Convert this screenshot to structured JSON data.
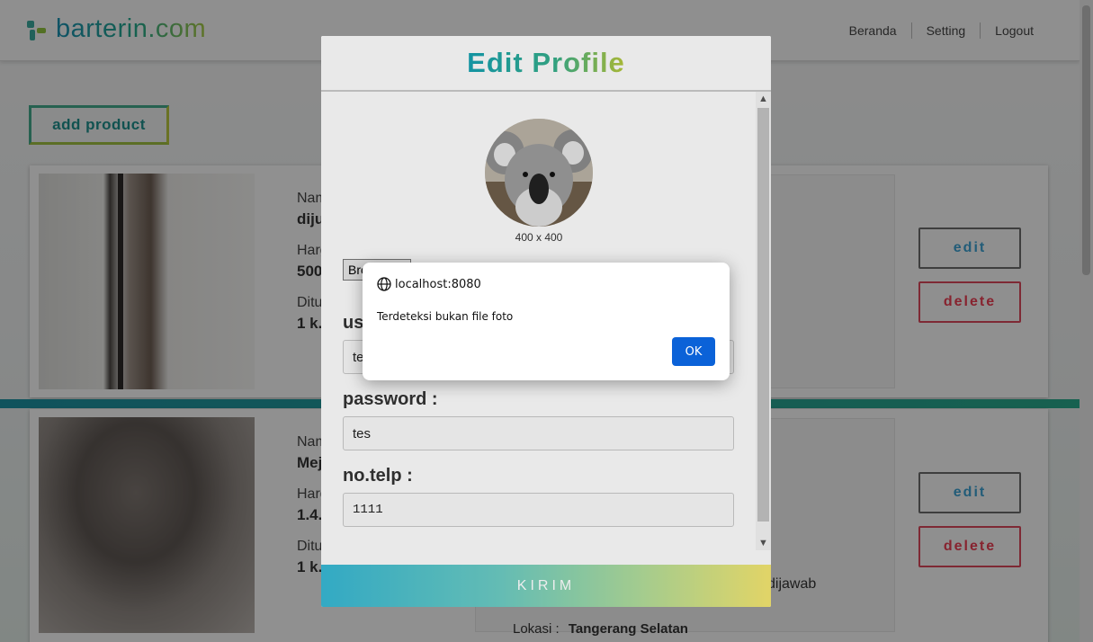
{
  "site": {
    "logo_text": "barterin.com"
  },
  "nav": {
    "items": [
      "Beranda",
      "Setting",
      "Logout"
    ]
  },
  "page": {
    "add_product_label": "add product",
    "products": [
      {
        "name_label": "Nama :",
        "name_value": "dijual ... pla...",
        "harga_label": "Harga :",
        "harga_value": "500...",
        "ditukar_label": "Ditukar :",
        "ditukar_value": "1 k...",
        "edit_label": "edit",
        "delete_label": "delete"
      },
      {
        "name_label": "Nama :",
        "name_value": "Mej... bis...",
        "harga_label": "Harga :",
        "harga_value": "1.4...",
        "ditukar_label": "Ditukar :",
        "ditukar_value": "1 k...",
        "desc_fragment": "dijawab",
        "lokasi_label": "Lokasi :",
        "lokasi_value": "Tangerang Selatan",
        "edit_label": "edit",
        "delete_label": "delete"
      }
    ]
  },
  "modal": {
    "title": "Edit Profile",
    "avatar_caption": "400 x 400",
    "browse_label": "Browse...",
    "username_label": "username :",
    "username_value": "tes",
    "password_label": "password :",
    "password_value": "tes",
    "telp_label": "no.telp :",
    "telp_value": "1111",
    "submit_label": "KIRIM"
  },
  "alert": {
    "origin": "localhost:8080",
    "message": "Terdeteksi bukan file foto",
    "ok_label": "OK"
  },
  "colors": {
    "brand_teal": "#25a88a",
    "brand_lime": "#b6c63a",
    "ok_blue": "#0b62d8",
    "delete_red": "#e83d52"
  }
}
